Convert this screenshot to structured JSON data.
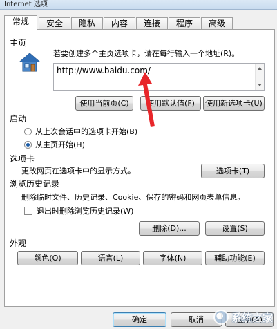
{
  "window": {
    "title": "Internet 选项"
  },
  "tabs": [
    "常规",
    "安全",
    "隐私",
    "内容",
    "连接",
    "程序",
    "高级"
  ],
  "home": {
    "section_title": "主页",
    "instruction": "若要创建多个主页选项卡，请在每行输入一个地址(R)。",
    "url": "http://www.baidu.com/",
    "btn_current": "使用当前页(C)",
    "btn_default": "使用默认值(F)",
    "btn_new_tab": "使用新选项卡(U)"
  },
  "startup": {
    "section_title": "启动",
    "option_last_session": "从上次会话中的选项卡开始(B)",
    "option_home": "从主页开始(H)",
    "selected": "option_home"
  },
  "tabs_section": {
    "section_title": "选项卡",
    "description": "更改网页在选项卡中的显示方式。",
    "btn": "选项卡(T)"
  },
  "history": {
    "section_title": "浏览历史记录",
    "description": "删除临时文件、历史记录、Cookie、保存的密码和网页表单信息。",
    "checkbox_label": "退出时删除浏览历史记录(W)",
    "checkbox_checked": false,
    "btn_delete": "删除(D)...",
    "btn_settings": "设置(S)"
  },
  "appearance": {
    "section_title": "外观",
    "btn_colors": "颜色(O)",
    "btn_languages": "语言(L)",
    "btn_fonts": "字体(N)",
    "btn_accessibility": "辅助功能(E)"
  },
  "footer": {
    "btn_ok": "确定",
    "btn_cancel": "取消",
    "btn_apply": "应用(A)"
  },
  "watermark": {
    "text": "系统之家"
  },
  "colors": {
    "arrow": "#e8262a",
    "accent": "#1a5ba6"
  }
}
